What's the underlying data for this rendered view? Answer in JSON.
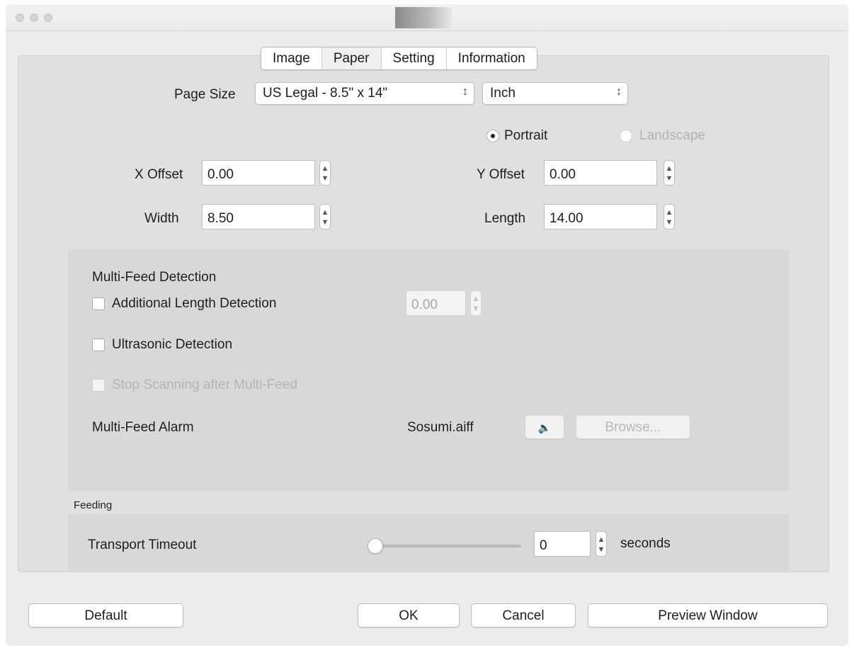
{
  "tabs": [
    {
      "label": "Image"
    },
    {
      "label": "Paper"
    },
    {
      "label": "Setting"
    },
    {
      "label": "Information"
    }
  ],
  "page_size": {
    "label": "Page Size",
    "value": "US Legal - 8.5\" x 14\"",
    "unit": "Inch"
  },
  "orientation": {
    "portrait_label": "Portrait",
    "landscape_label": "Landscape",
    "selected": "Portrait"
  },
  "offsets": {
    "x_label": "X Offset",
    "x_value": "0.00",
    "y_label": "Y Offset",
    "y_value": "0.00",
    "width_label": "Width",
    "width_value": "8.50",
    "length_label": "Length",
    "length_value": "14.00"
  },
  "multifeed": {
    "title": "Multi-Feed Detection",
    "additional_label": "Additional Length Detection",
    "additional_value": "0.00",
    "ultrasonic_label": "Ultrasonic Detection",
    "stop_label": "Stop Scanning after Multi-Feed",
    "alarm_label": "Multi-Feed Alarm",
    "alarm_file": "Sosumi.aiff",
    "browse_label": "Browse..."
  },
  "feeding": {
    "section_label": "Feeding",
    "timeout_label": "Transport Timeout",
    "timeout_value": "0",
    "timeout_unit": "seconds"
  },
  "buttons": {
    "default": "Default",
    "ok": "OK",
    "cancel": "Cancel",
    "preview": "Preview Window"
  },
  "icons": {
    "speaker": "speaker-icon",
    "stepper": "stepper-arrows-icon",
    "select_arrow": "updown-chevron-icon"
  }
}
